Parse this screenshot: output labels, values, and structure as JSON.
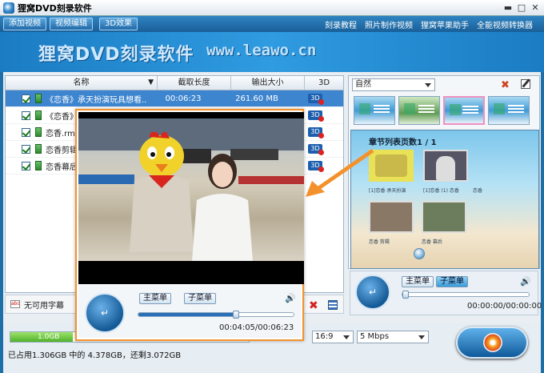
{
  "app": {
    "title": "狸窝DVD刻录软件"
  },
  "toolbar": {
    "buttons": [
      "添加视频",
      "视频编辑",
      "3D效果"
    ]
  },
  "top_links": [
    "刻录教程",
    "照片制作视频",
    "狸窝苹果助手",
    "全能视频转换器"
  ],
  "banner": {
    "title": "狸窝DVD刻录软件",
    "url": "www.leawo.cn"
  },
  "list": {
    "columns": {
      "name": "名称",
      "duration": "截取长度",
      "size": "输出大小",
      "three_d": "3D"
    },
    "rows": [
      {
        "name": "《恋香》承天扮演玩具想看...",
        "duration": "00:06:23",
        "size": "261.60 MB",
        "selected": true
      },
      {
        "name": "《恋香》",
        "duration": "",
        "size": "",
        "selected": false
      },
      {
        "name": "恋香.rmv",
        "duration": "",
        "size": "",
        "selected": false
      },
      {
        "name": "恋香剪辑",
        "duration": "",
        "size": "",
        "selected": false
      },
      {
        "name": "恋香幕后",
        "duration": "",
        "size": "",
        "selected": false
      }
    ],
    "three_d_label": "3D"
  },
  "subtitle": {
    "label": "无可用字幕"
  },
  "menu_panel": {
    "theme": "自然",
    "chapter_title": "章节列表页数1 / 1",
    "chapter_labels": [
      "[1]恋香 承天扮演",
      "[1]恋香 (1) 恋香",
      "恋香",
      "恋香 剪辑",
      "恋香 幕后"
    ]
  },
  "player": {
    "main_menu": "主菜单",
    "sub_menu": "子菜单",
    "time": "00:04:05/00:06:23",
    "progress": 0.63
  },
  "preview_ctrl": {
    "main_menu": "主菜单",
    "sub_menu": "子菜单",
    "time": "00:00:00/00:00:00",
    "progress": 0.0
  },
  "bottom": {
    "disc_used_label": "1.0GB",
    "usage_text": "已占用1.306GB 中的 4.378GB，还剩3.072GB",
    "aspect": "16:9",
    "bitrate": "5 Mbps"
  },
  "colors": {
    "accent": "#f3922c",
    "selection": "#3d85cf",
    "brand": "#1d6fa8"
  }
}
